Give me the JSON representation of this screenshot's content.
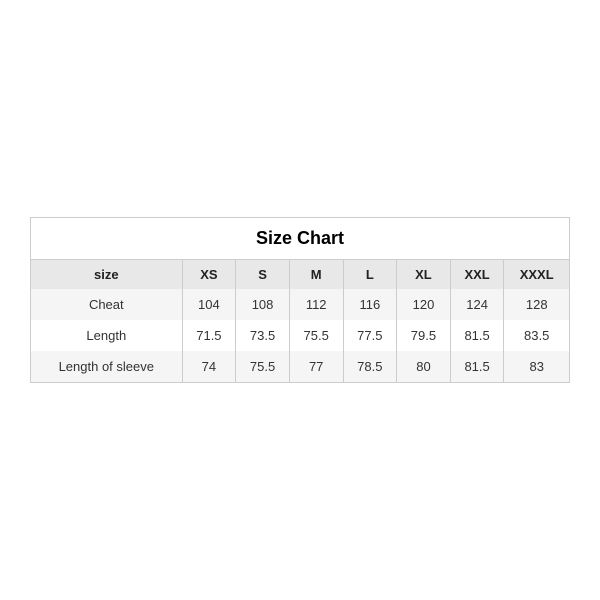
{
  "table": {
    "title": "Size Chart",
    "columns": [
      "size",
      "XS",
      "S",
      "M",
      "L",
      "XL",
      "XXL",
      "XXXL"
    ],
    "rows": [
      {
        "label": "Cheat",
        "values": [
          "104",
          "108",
          "112",
          "116",
          "120",
          "124",
          "128"
        ]
      },
      {
        "label": "Length",
        "values": [
          "71.5",
          "73.5",
          "75.5",
          "77.5",
          "79.5",
          "81.5",
          "83.5"
        ]
      },
      {
        "label": "Length of sleeve",
        "values": [
          "74",
          "75.5",
          "77",
          "78.5",
          "80",
          "81.5",
          "83"
        ]
      }
    ]
  }
}
